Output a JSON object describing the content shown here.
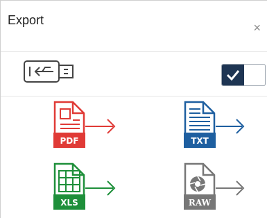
{
  "dialog": {
    "title": "Export",
    "close_glyph": "×"
  },
  "usb": {
    "icon": "usb-drive-icon",
    "toggle_checked": true,
    "toggle_color": "#1e3553"
  },
  "formats": [
    {
      "label": "PDF",
      "color": "#e03a36",
      "icon": "pdf-file-icon"
    },
    {
      "label": "TXT",
      "color": "#1e5fa0",
      "icon": "txt-file-icon"
    },
    {
      "label": "XLS",
      "color": "#1e8f3a",
      "icon": "xls-file-icon"
    },
    {
      "label": "RAW",
      "color": "#777777",
      "icon": "raw-file-icon"
    }
  ]
}
